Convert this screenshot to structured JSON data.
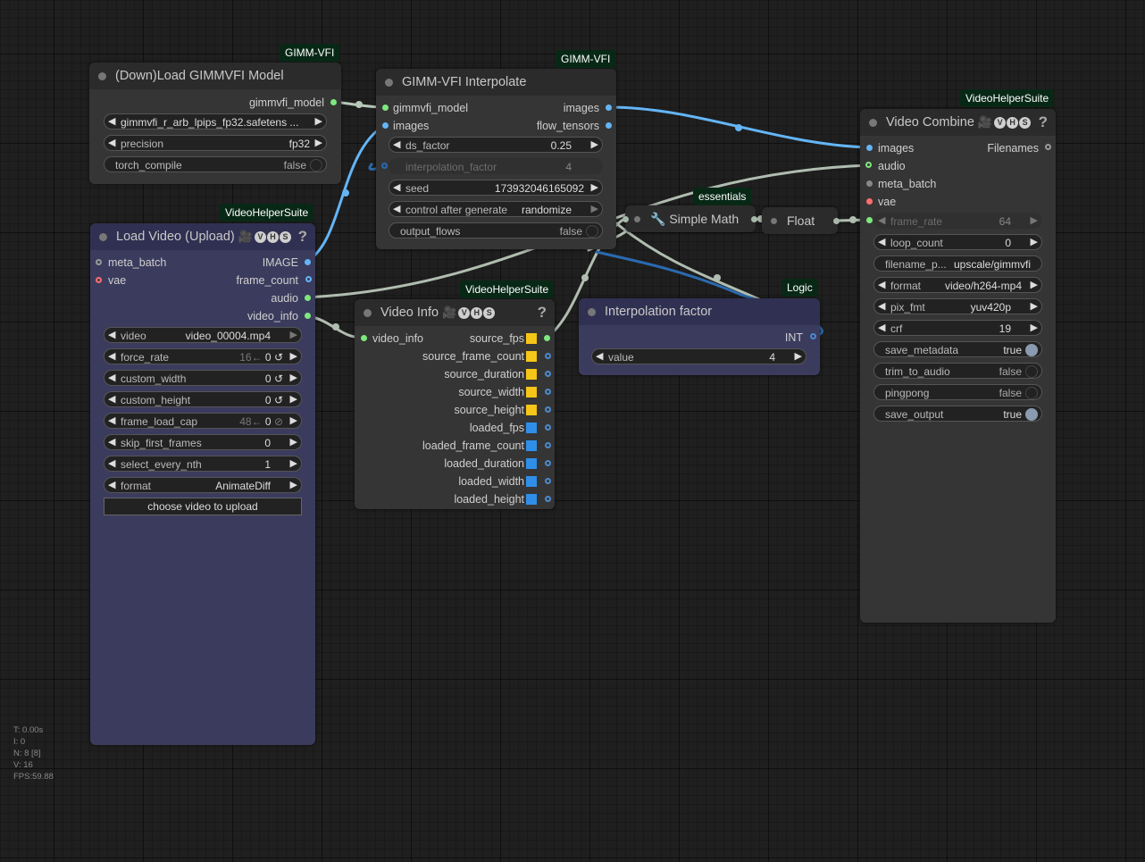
{
  "badges": {
    "load_model": "GIMM-VFI",
    "interpolate": "GIMM-VFI",
    "video_combine": "VideoHelperSuite",
    "load_video": "VideoHelperSuite",
    "video_info": "VideoHelperSuite",
    "simple_math": "essentials",
    "interp_factor": "Logic"
  },
  "vhs_letters": [
    "V",
    "H",
    "S"
  ],
  "load_model": {
    "title": "(Down)Load GIMMVFI Model",
    "output": "gimmvfi_model",
    "model_value": "gimmvfi_r_arb_lpips_fp32.safetens ...",
    "precision_label": "precision",
    "precision_value": "fp32",
    "torch_compile_label": "torch_compile",
    "torch_compile_value": "false"
  },
  "interpolate": {
    "title": "GIMM-VFI Interpolate",
    "in_model": "gimmvfi_model",
    "in_images": "images",
    "out_images": "images",
    "out_flow": "flow_tensors",
    "ds_factor_label": "ds_factor",
    "ds_factor_value": "0.25",
    "interp_label": "interpolation_factor",
    "interp_value": "4",
    "seed_label": "seed",
    "seed_value": "173932046165092",
    "control_label": "control after generate",
    "control_value": "randomize",
    "flows_label": "output_flows",
    "flows_value": "false"
  },
  "video_combine": {
    "title": "Video Combine",
    "in_images": "images",
    "in_audio": "audio",
    "in_meta": "meta_batch",
    "in_vae": "vae",
    "out_filenames": "Filenames",
    "frame_rate_label": "frame_rate",
    "frame_rate_value": "64",
    "loop_count_label": "loop_count",
    "loop_count_value": "0",
    "filename_label": "filename_p...",
    "filename_value": "upscale/gimmvfi",
    "format_label": "format",
    "format_value": "video/h264-mp4",
    "pix_fmt_label": "pix_fmt",
    "pix_fmt_value": "yuv420p",
    "crf_label": "crf",
    "crf_value": "19",
    "save_metadata_label": "save_metadata",
    "save_metadata_value": "true",
    "trim_label": "trim_to_audio",
    "trim_value": "false",
    "pingpong_label": "pingpong",
    "pingpong_value": "false",
    "save_output_label": "save_output",
    "save_output_value": "true"
  },
  "simple_math": {
    "title": "Simple Math",
    "icon": "wrench-icon"
  },
  "float_node": {
    "title": "Float"
  },
  "load_video": {
    "title": "Load Video (Upload)",
    "in_meta": "meta_batch",
    "in_vae": "vae",
    "out_image": "IMAGE",
    "out_frame_count": "frame_count",
    "out_audio": "audio",
    "out_video_info": "video_info",
    "video_label": "video",
    "video_value": "video_00004.mp4",
    "force_rate_label": "force_rate",
    "force_rate_hint": "16←",
    "force_rate_value": "0",
    "custom_width_label": "custom_width",
    "custom_width_value": "0",
    "custom_height_label": "custom_height",
    "custom_height_value": "0",
    "frame_load_cap_label": "frame_load_cap",
    "frame_load_cap_hint": "48←",
    "frame_load_cap_value": "0",
    "skip_label": "skip_first_frames",
    "skip_value": "0",
    "every_nth_label": "select_every_nth",
    "every_nth_value": "1",
    "format_label": "format",
    "format_value": "AnimateDiff",
    "upload_button": "choose video to upload"
  },
  "video_info": {
    "title": "Video Info",
    "input": "video_info",
    "outputs": [
      "source_fps",
      "source_frame_count",
      "source_duration",
      "source_width",
      "source_height",
      "loaded_fps",
      "loaded_frame_count",
      "loaded_duration",
      "loaded_width",
      "loaded_height"
    ]
  },
  "interp_factor": {
    "title": "Interpolation factor",
    "output": "INT",
    "value_label": "value",
    "value": "4"
  },
  "stats": {
    "t": "T: 0.00s",
    "i": "I: 0",
    "n": "N: 8 [8]",
    "v": "V: 16",
    "fps": "FPS:59.88"
  },
  "colors": {
    "image_link": "#64b5f6",
    "generic_link": "#a8b8a8",
    "model_link": "#a8c8a8",
    "int_link": "#2a6ab0",
    "badge_bg": "#082816"
  }
}
